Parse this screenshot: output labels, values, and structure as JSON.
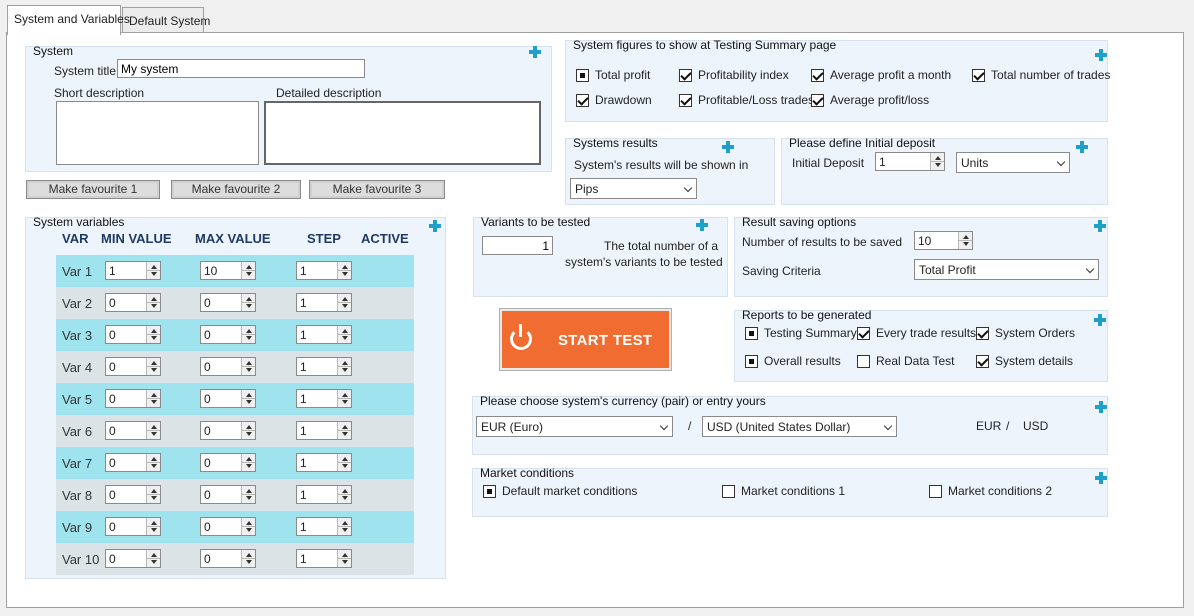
{
  "tabs": [
    "System and Variables",
    "Default System"
  ],
  "system": {
    "title": "System",
    "system_title_label": "System title",
    "system_title_value": "My system",
    "short_desc_label": "Short description",
    "detailed_desc_label": "Detailed description"
  },
  "favourites": [
    "Make favourite 1",
    "Make favourite 2",
    "Make favourite 3"
  ],
  "variables": {
    "title": "System variables",
    "headers": [
      "VAR",
      "MIN VALUE",
      "MAX VALUE",
      "STEP",
      "ACTIVE"
    ],
    "rows": [
      {
        "name": "Var 1",
        "min": "1",
        "max": "10",
        "step": "1"
      },
      {
        "name": "Var 2",
        "min": "0",
        "max": "0",
        "step": "1"
      },
      {
        "name": "Var 3",
        "min": "0",
        "max": "0",
        "step": "1"
      },
      {
        "name": "Var 4",
        "min": "0",
        "max": "0",
        "step": "1"
      },
      {
        "name": "Var 5",
        "min": "0",
        "max": "0",
        "step": "1"
      },
      {
        "name": "Var 6",
        "min": "0",
        "max": "0",
        "step": "1"
      },
      {
        "name": "Var 7",
        "min": "0",
        "max": "0",
        "step": "1"
      },
      {
        "name": "Var 8",
        "min": "0",
        "max": "0",
        "step": "1"
      },
      {
        "name": "Var 9",
        "min": "0",
        "max": "0",
        "step": "1"
      },
      {
        "name": "Var 10",
        "min": "0",
        "max": "0",
        "step": "1"
      }
    ]
  },
  "figures": {
    "title": "System figures to show at Testing Summary page",
    "items": [
      {
        "label": "Total profit",
        "state": "filled"
      },
      {
        "label": "Profitability index",
        "state": "checked"
      },
      {
        "label": "Average profit a month",
        "state": "checked"
      },
      {
        "label": "Total number of trades",
        "state": "checked"
      },
      {
        "label": "Drawdown",
        "state": "checked"
      },
      {
        "label": "Profitable/Loss trades",
        "state": "checked"
      },
      {
        "label": "Average profit/loss",
        "state": "checked"
      }
    ]
  },
  "results": {
    "title": "Systems results",
    "label": "System's results will be shown in",
    "value": "Pips"
  },
  "deposit": {
    "title": "Please define Initial deposit",
    "label": "Initial Deposit",
    "value": "1",
    "unit": "Units"
  },
  "variants": {
    "title": "Variants to be tested",
    "value": "1",
    "line1": "The total number of a",
    "line2": "system's variants to be tested"
  },
  "saving": {
    "title": "Result saving options",
    "count_label": "Number of results to be saved",
    "count_value": "10",
    "criteria_label": "Saving Criteria",
    "criteria_value": "Total Profit"
  },
  "start_label": "START TEST",
  "reports": {
    "title": "Reports to be generated",
    "items": [
      {
        "label": "Testing Summary",
        "state": "filled"
      },
      {
        "label": "Every trade results",
        "state": "checked"
      },
      {
        "label": "System Orders",
        "state": "checked"
      },
      {
        "label": "Overall results",
        "state": "filled"
      },
      {
        "label": "Real Data Test",
        "state": "unchecked"
      },
      {
        "label": "System details",
        "state": "checked"
      }
    ]
  },
  "currency": {
    "title": "Please choose system's currency (pair) or entry yours",
    "base": "EUR (Euro)",
    "sep": "/",
    "quote": "USD (United States Dollar)",
    "base_code": "EUR",
    "sep2": "/",
    "quote_code": "USD"
  },
  "market": {
    "title": "Market conditions",
    "items": [
      {
        "label": "Default market conditions",
        "state": "filled"
      },
      {
        "label": "Market conditions 1",
        "state": "unchecked"
      },
      {
        "label": "Market conditions 2",
        "state": "unchecked"
      }
    ]
  },
  "colors": {
    "accent": "#1ea0c8",
    "start": "#f06c30",
    "row_alt": "#9ee3ee",
    "panel_bg": "#eef4fb"
  }
}
